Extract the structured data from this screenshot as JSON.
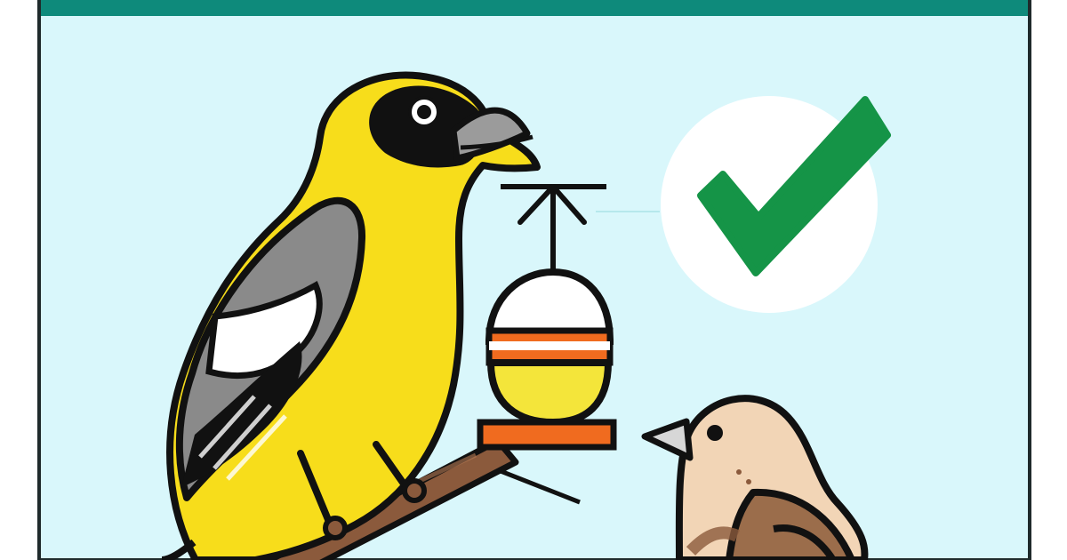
{
  "scene": {
    "colors": {
      "frame_border": "#1f2a2b",
      "top_bar": "#0e8a7b",
      "panel_bg": "#d9f7fb",
      "yellow_bird_body": "#f7dd1b",
      "yellow_bird_mask": "#111111",
      "wing_gray": "#8a8a8a",
      "beak_gray": "#9b9b9b",
      "feeder_white": "#ffffff",
      "feeder_yellow": "#f4e53a",
      "feeder_orange": "#f06b1f",
      "branch_brown": "#8b5a3c",
      "small_bird_tan": "#f2d5b6",
      "small_bird_wing": "#9b6d4b",
      "check_circle": "#ffffff",
      "check_green": "#159447"
    },
    "icons": {
      "main_bird": "yellow-songbird-icon",
      "feeder": "hanging-bird-feeder-icon",
      "small_bird": "small-brown-bird-icon",
      "approval": "green-checkmark-icon"
    }
  }
}
